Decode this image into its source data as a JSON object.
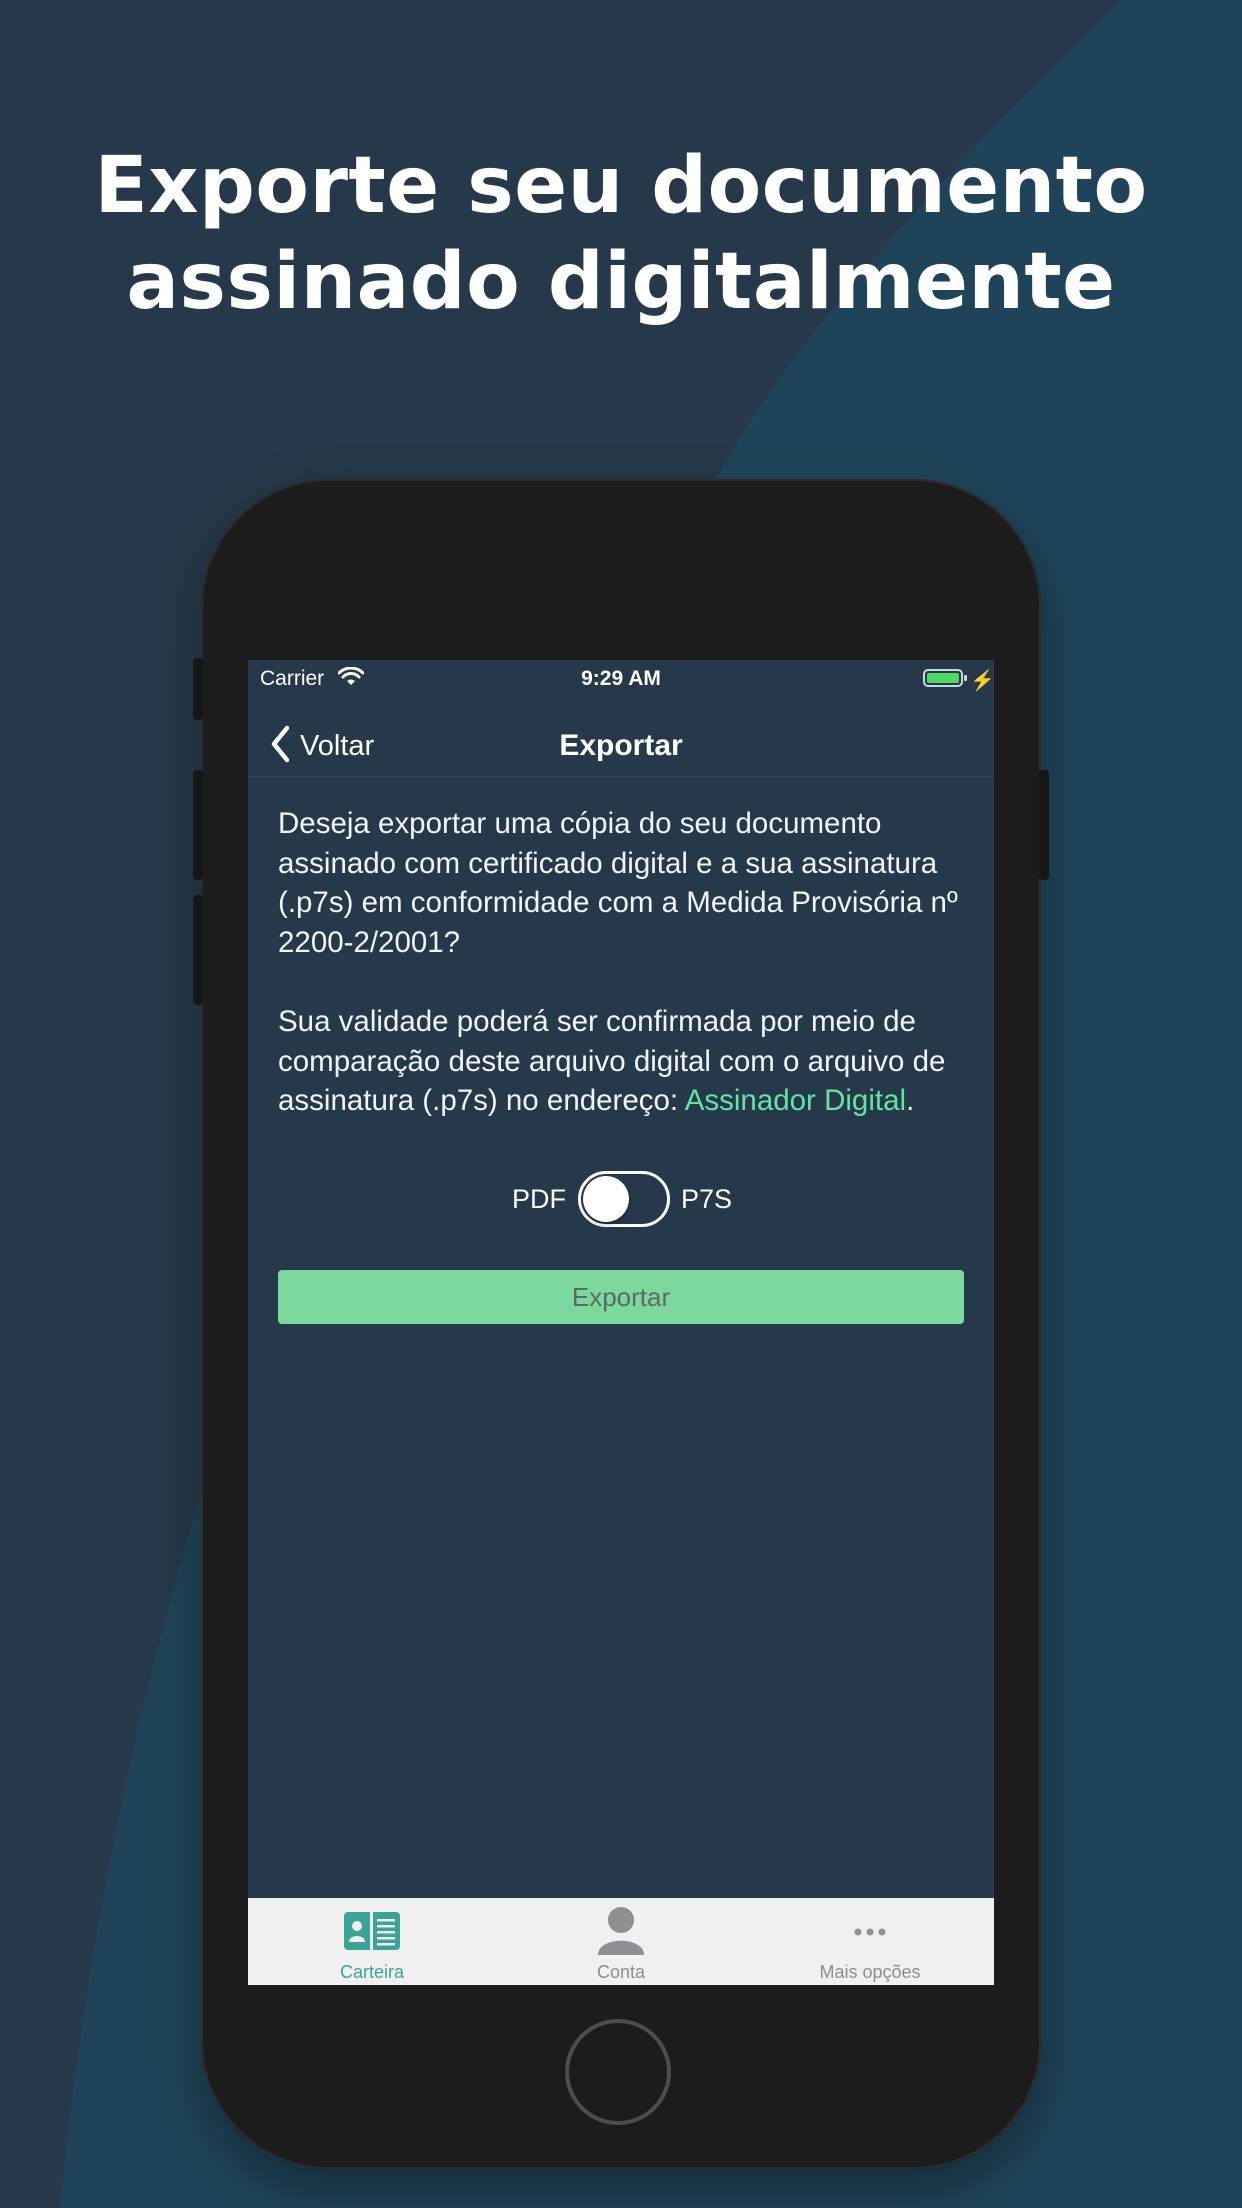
{
  "headline": {
    "line1": "Exporte seu documento",
    "line2": "assinado digitalmente"
  },
  "status_bar": {
    "carrier": "Carrier",
    "time": "9:29 AM"
  },
  "navbar": {
    "back_label": "Voltar",
    "title": "Exportar"
  },
  "content": {
    "paragraph1": "Deseja exportar uma cópia do seu documento assinado com certificado digital e a sua assinatura (.p7s) em conformidade com a Medida Provisória nº 2200-2/2001?",
    "paragraph2_text": "Sua validade poderá ser confirmada por meio de comparação deste arquivo digital com o arquivo de assinatura (.p7s) no endereço: ",
    "paragraph2_link": "Assinador Digital",
    "paragraph2_end": "."
  },
  "format_toggle": {
    "left_label": "PDF",
    "right_label": "P7S",
    "selected": "PDF"
  },
  "export_button": {
    "label": "Exportar"
  },
  "tabbar": {
    "tabs": [
      {
        "label": "Carteira",
        "icon": "wallet-card-icon",
        "active": true
      },
      {
        "label": "Conta",
        "icon": "person-icon",
        "active": false
      },
      {
        "label": "Mais opções",
        "icon": "more-dots-icon",
        "active": false
      }
    ]
  },
  "colors": {
    "background": "#26394a",
    "screen_background": "#25394a",
    "accent_green": "#65e3a3",
    "button_green": "#7cd89d",
    "tab_active": "#3aa597",
    "tab_inactive": "#8e8e93"
  }
}
